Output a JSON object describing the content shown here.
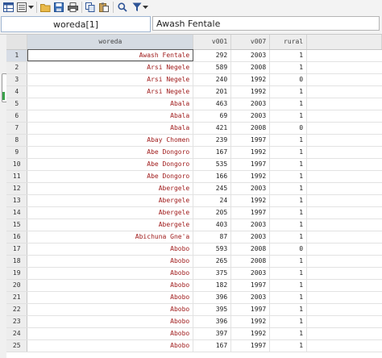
{
  "toolbar": {
    "icons": [
      "data-editor-icon",
      "variables-manager-icon",
      "dropdown-arrow-icon",
      "open-icon",
      "save-icon",
      "print-icon",
      "copy-icon",
      "paste-icon",
      "find-icon",
      "filter-icon",
      "dropdown-arrow-icon"
    ]
  },
  "editbar": {
    "cell_reference": "woreda[1]",
    "cell_value": "Awash Fentale"
  },
  "grid": {
    "columns": [
      "woreda",
      "v001",
      "v007",
      "rural"
    ],
    "rows": [
      {
        "n": "1",
        "woreda": "Awash Fentale",
        "v001": "292",
        "v007": "2003",
        "rural": "1"
      },
      {
        "n": "2",
        "woreda": "Arsi Negele",
        "v001": "589",
        "v007": "2008",
        "rural": "1"
      },
      {
        "n": "3",
        "woreda": "Arsi Negele",
        "v001": "240",
        "v007": "1992",
        "rural": "0"
      },
      {
        "n": "4",
        "woreda": "Arsi Negele",
        "v001": "201",
        "v007": "1992",
        "rural": "1"
      },
      {
        "n": "5",
        "woreda": "Abala",
        "v001": "463",
        "v007": "2003",
        "rural": "1"
      },
      {
        "n": "6",
        "woreda": "Abala",
        "v001": "69",
        "v007": "2003",
        "rural": "1"
      },
      {
        "n": "7",
        "woreda": "Abala",
        "v001": "421",
        "v007": "2008",
        "rural": "0"
      },
      {
        "n": "8",
        "woreda": "Abay Chomen",
        "v001": "239",
        "v007": "1997",
        "rural": "1"
      },
      {
        "n": "9",
        "woreda": "Abe Dongoro",
        "v001": "167",
        "v007": "1992",
        "rural": "1"
      },
      {
        "n": "10",
        "woreda": "Abe Dongoro",
        "v001": "535",
        "v007": "1997",
        "rural": "1"
      },
      {
        "n": "11",
        "woreda": "Abe Dongoro",
        "v001": "166",
        "v007": "1992",
        "rural": "1"
      },
      {
        "n": "12",
        "woreda": "Abergele",
        "v001": "245",
        "v007": "2003",
        "rural": "1"
      },
      {
        "n": "13",
        "woreda": "Abergele",
        "v001": "24",
        "v007": "1992",
        "rural": "1"
      },
      {
        "n": "14",
        "woreda": "Abergele",
        "v001": "205",
        "v007": "1997",
        "rural": "1"
      },
      {
        "n": "15",
        "woreda": "Abergele",
        "v001": "403",
        "v007": "2003",
        "rural": "1"
      },
      {
        "n": "16",
        "woreda": "Abichuna Gne'a",
        "v001": "87",
        "v007": "2003",
        "rural": "1"
      },
      {
        "n": "17",
        "woreda": "Abobo",
        "v001": "593",
        "v007": "2008",
        "rural": "0"
      },
      {
        "n": "18",
        "woreda": "Abobo",
        "v001": "265",
        "v007": "2008",
        "rural": "1"
      },
      {
        "n": "19",
        "woreda": "Abobo",
        "v001": "375",
        "v007": "2003",
        "rural": "1"
      },
      {
        "n": "20",
        "woreda": "Abobo",
        "v001": "182",
        "v007": "1997",
        "rural": "1"
      },
      {
        "n": "21",
        "woreda": "Abobo",
        "v001": "396",
        "v007": "2003",
        "rural": "1"
      },
      {
        "n": "22",
        "woreda": "Abobo",
        "v001": "395",
        "v007": "1997",
        "rural": "1"
      },
      {
        "n": "23",
        "woreda": "Abobo",
        "v001": "396",
        "v007": "1992",
        "rural": "1"
      },
      {
        "n": "24",
        "woreda": "Abobo",
        "v001": "397",
        "v007": "1992",
        "rural": "1"
      },
      {
        "n": "25",
        "woreda": "Abobo",
        "v001": "167",
        "v007": "1997",
        "rural": "1"
      }
    ]
  },
  "colors": {
    "string_text": "#a01d1d",
    "numeric_text": "#222222",
    "header_bg": "#ededed"
  }
}
